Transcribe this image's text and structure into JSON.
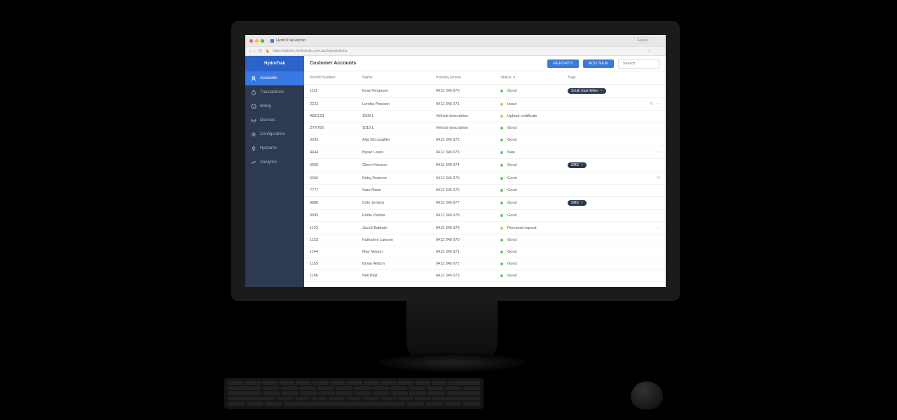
{
  "colors": {
    "accent": "#3a7bd5",
    "sidebar": "#2d3a4f",
    "sidebar_active": "#3979e6"
  },
  "chrome": {
    "tab_title": "HydroTrak Admin",
    "url": "https://admin.hydrotrak.com.au/transactions",
    "user_label": "August"
  },
  "brand": "HydroTrak",
  "sidebar": {
    "items": [
      {
        "label": "Accounts",
        "icon": "users-icon",
        "active": true
      },
      {
        "label": "Transactions",
        "icon": "drop-icon"
      },
      {
        "label": "Billing",
        "icon": "info-icon"
      },
      {
        "label": "Devices",
        "icon": "antenna-icon"
      },
      {
        "label": "Configuration",
        "icon": "gear-icon"
      },
      {
        "label": "Hydrants",
        "icon": "hydrant-icon"
      },
      {
        "label": "Analytics",
        "icon": "chart-icon"
      }
    ]
  },
  "header": {
    "title": "Customer Accounts",
    "reports_label": "REPORTS",
    "add_new_label": "ADD NEW",
    "search_placeholder": "Search"
  },
  "columns": {
    "permit": "Permit Number",
    "name": "Name",
    "phone": "Primary phone",
    "status": "Status",
    "tags": "Tags"
  },
  "status_colors": {
    "Good": "green",
    "New": "green",
    "Issue": "amber",
    "Upload certificate": "amber",
    "Removal request": "amber"
  },
  "rows": [
    {
      "permit": "1111",
      "name": "Evan Ferguson",
      "phone": "0412 345 670",
      "status": "Good",
      "tags": [
        "South East Water"
      ],
      "actions": []
    },
    {
      "permit": "2222",
      "name": "Loretta Pearson",
      "phone": "0412 345 671",
      "status": "Issue",
      "tags": [],
      "actions": [
        "mail",
        "more"
      ]
    },
    {
      "permit": "ABC123",
      "name": "1500 L",
      "phone": "Vehicle description",
      "status": "Upload certificate",
      "tags": [],
      "actions": []
    },
    {
      "permit": "ZYX789",
      "name": "1010 L",
      "phone": "Vehicle description",
      "status": "Good",
      "tags": [],
      "actions": []
    },
    {
      "permit": "3333",
      "name": "Ada McLaughlin",
      "phone": "0412 345 672",
      "status": "Good",
      "tags": [],
      "actions": []
    },
    {
      "permit": "4444",
      "name": "Bryan Lewis",
      "phone": "0412 345 673",
      "status": "New",
      "tags": [],
      "actions": [
        "more"
      ]
    },
    {
      "permit": "5555",
      "name": "Glenn Hanson",
      "phone": "0412 345 674",
      "status": "Good",
      "tags": [
        "SMS"
      ],
      "actions": []
    },
    {
      "permit": "6666",
      "name": "Ruby Pearson",
      "phone": "0412 345 675",
      "status": "Good",
      "tags": [],
      "actions": [
        "mail"
      ]
    },
    {
      "permit": "7777",
      "name": "Sara Mann",
      "phone": "0412 345 676",
      "status": "Good",
      "tags": [],
      "actions": []
    },
    {
      "permit": "8888",
      "name": "Cole Jenkins",
      "phone": "0412 345 677",
      "status": "Good",
      "tags": [
        "SMS"
      ],
      "actions": []
    },
    {
      "permit": "9999",
      "name": "Eddie Palmer",
      "phone": "0412 345 678",
      "status": "Good",
      "tags": [],
      "actions": []
    },
    {
      "permit": "1122",
      "name": "Jacob Baldwin",
      "phone": "0412 345 679",
      "status": "Removal request",
      "tags": [],
      "actions": [
        "more"
      ]
    },
    {
      "permit": "1133",
      "name": "Katharine Lawson",
      "phone": "0412 345 670",
      "status": "Good",
      "tags": [],
      "actions": []
    },
    {
      "permit": "1144",
      "name": "May Nelson",
      "phone": "0412 345 671",
      "status": "Good",
      "tags": [],
      "actions": []
    },
    {
      "permit": "1155",
      "name": "Bryan Allison",
      "phone": "0412 345 672",
      "status": "Good",
      "tags": [],
      "actions": []
    },
    {
      "permit": "1166",
      "name": "Nell Blair",
      "phone": "0412 345 673",
      "status": "Good",
      "tags": [],
      "actions": []
    }
  ]
}
